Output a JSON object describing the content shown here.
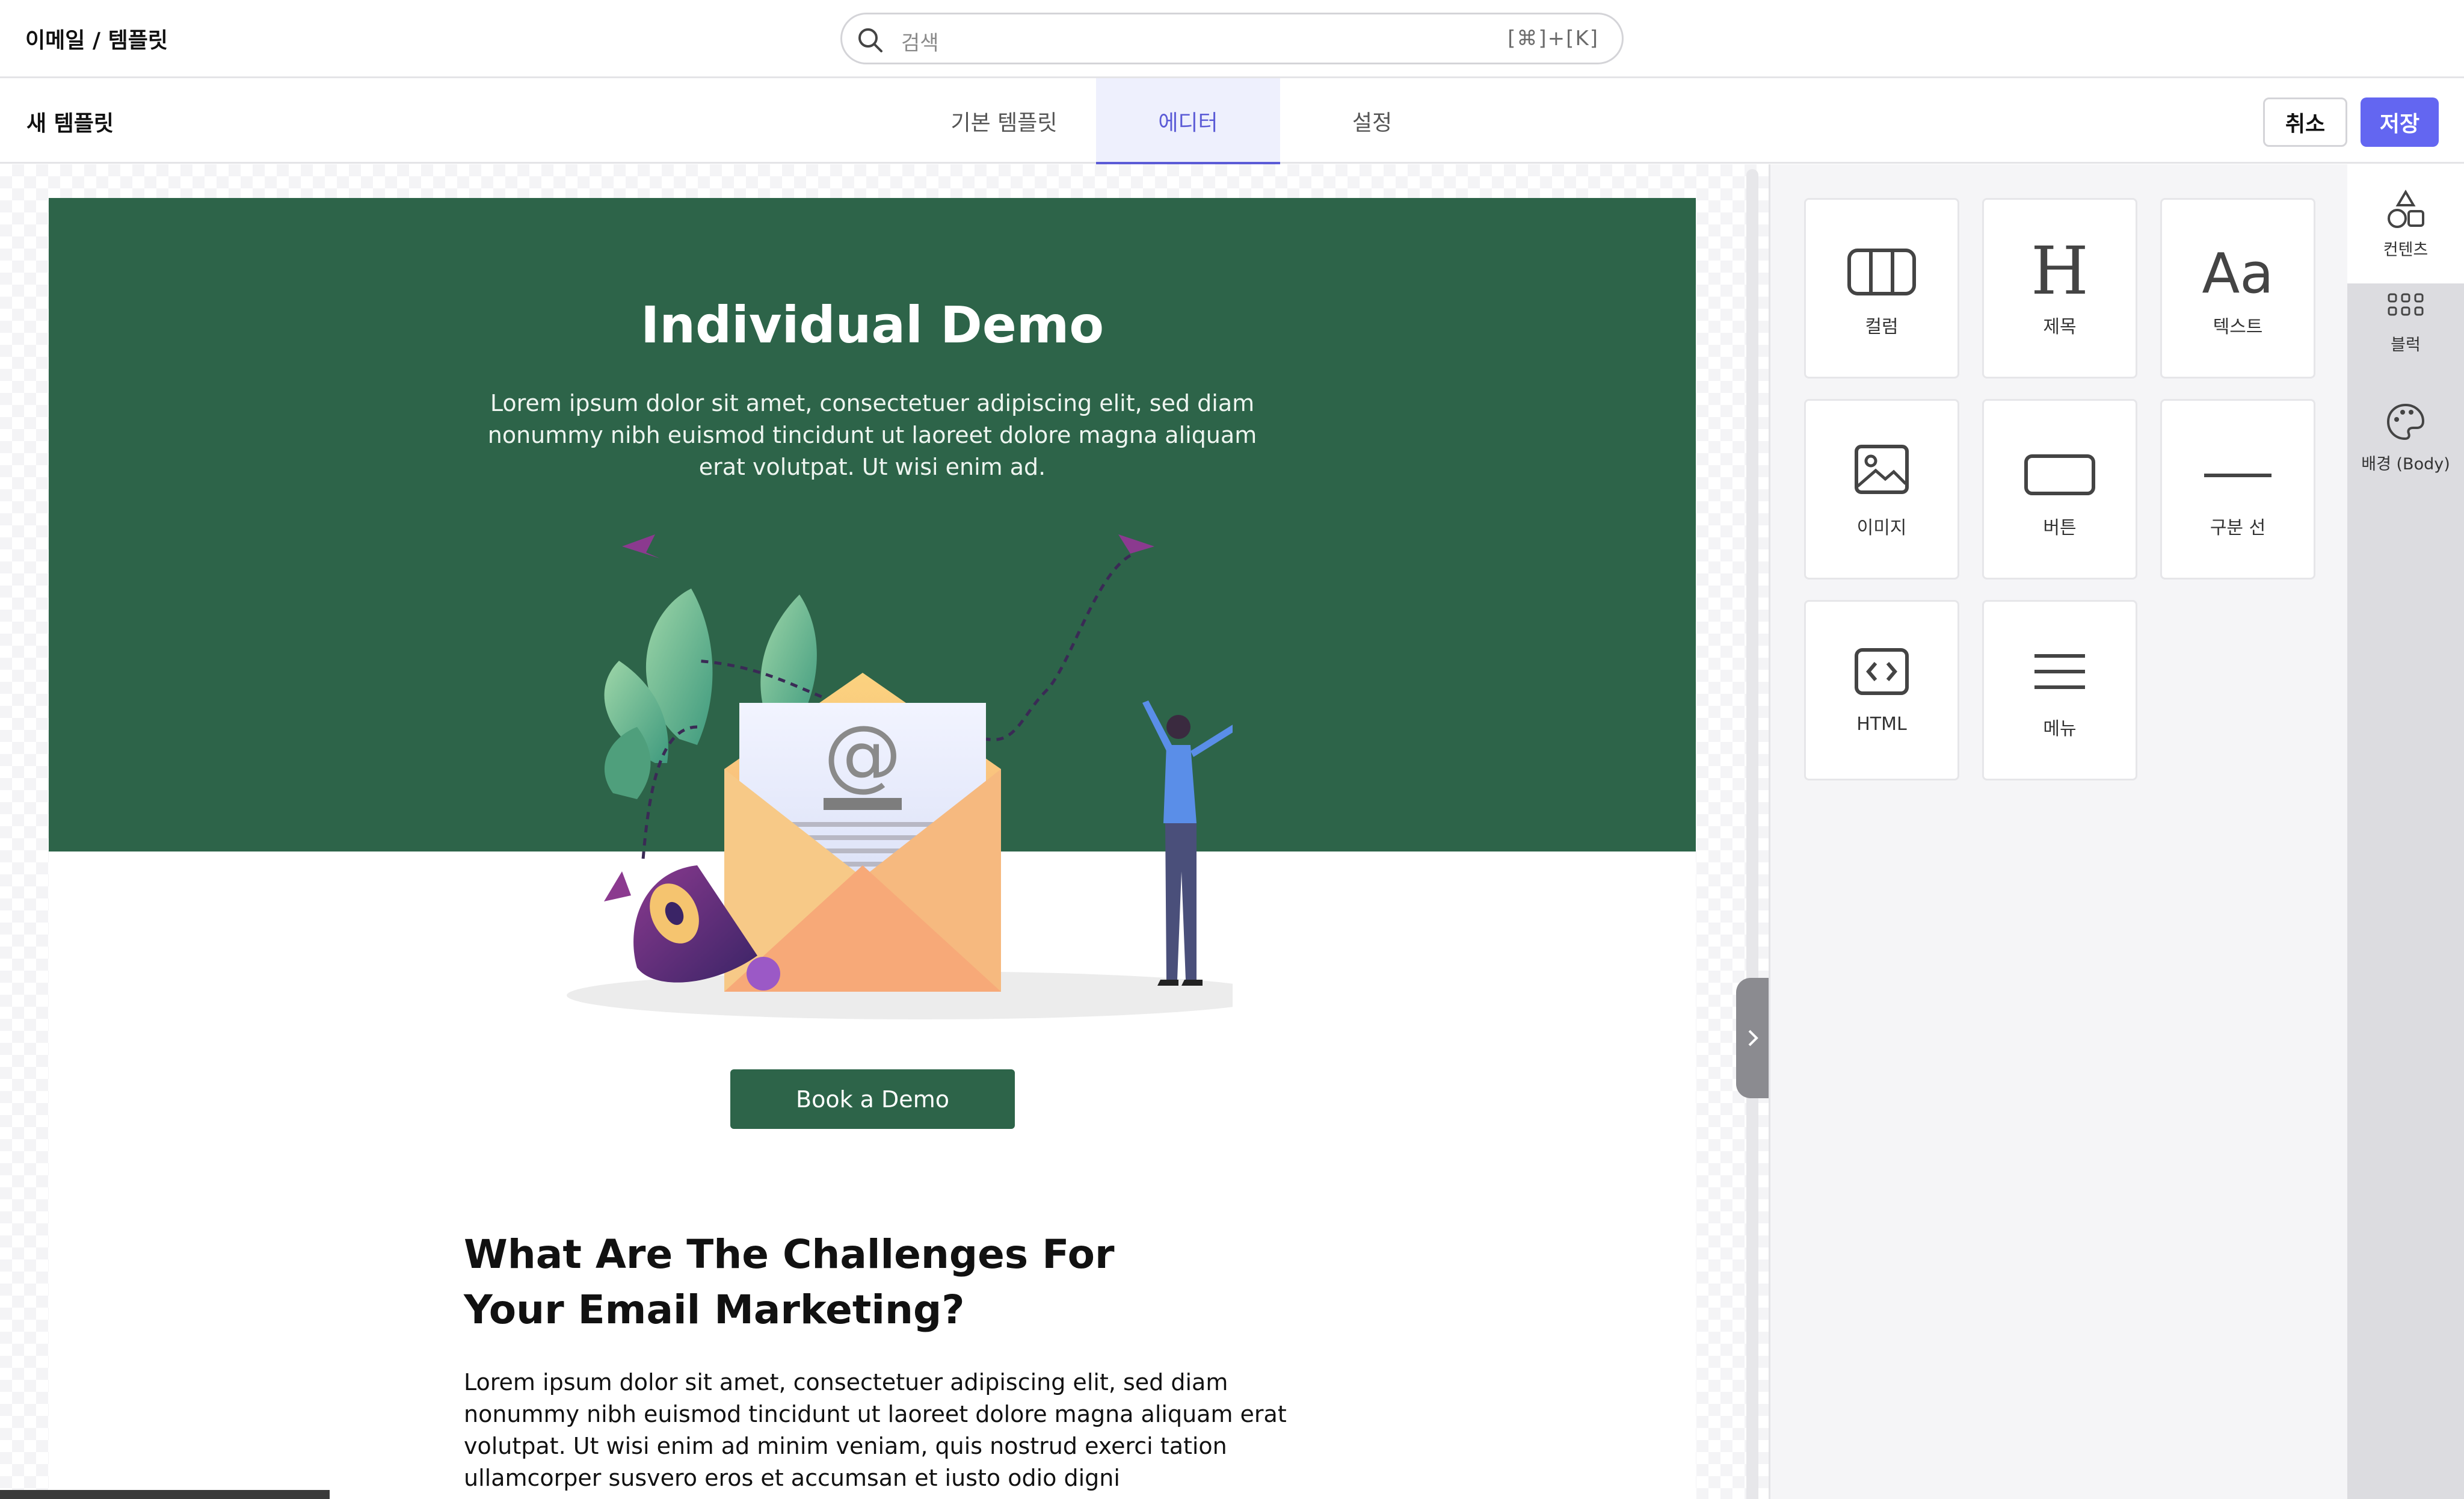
{
  "header": {
    "breadcrumb": "이메일 / 템플릿",
    "search": {
      "placeholder": "검색",
      "shortcut": "[⌘]+[K]"
    }
  },
  "toolbar": {
    "template_name": "새 템플릿",
    "tabs": [
      {
        "label": "기본 템플릿",
        "active": false
      },
      {
        "label": "에디터",
        "active": true
      },
      {
        "label": "설정",
        "active": false
      }
    ],
    "cancel_label": "취소",
    "save_label": "저장"
  },
  "email": {
    "hero_title": "Individual Demo",
    "hero_body": "Lorem ipsum dolor sit amet, consectetuer adipiscing elit, sed diam nonummy nibh euismod tincidunt ut laoreet dolore magna aliquam erat volutpat. Ut wisi enim ad.",
    "cta_label": "Book a Demo",
    "section_title": "What Are The Challenges For Your Email Marketing?",
    "section_body": "Lorem ipsum dolor sit amet, consectetuer adipiscing elit, sed diam nonummy nibh euismod tincidunt ut laoreet dolore magna aliquam erat volutpat. Ut wisi enim ad minim veniam, quis nostrud exerci tation ullamcorper susvero eros et accumsan et iusto odio digni"
  },
  "panel": {
    "blocks": [
      {
        "label": "컬럼",
        "icon": "columns-icon"
      },
      {
        "label": "제목",
        "icon": "heading-icon"
      },
      {
        "label": "텍스트",
        "icon": "text-icon"
      },
      {
        "label": "이미지",
        "icon": "image-icon"
      },
      {
        "label": "버튼",
        "icon": "button-icon"
      },
      {
        "label": "구분 선",
        "icon": "divider-icon"
      },
      {
        "label": "HTML",
        "icon": "html-code-icon"
      },
      {
        "label": "메뉴",
        "icon": "menu-icon"
      }
    ]
  },
  "rail": {
    "items": [
      {
        "label": "컨텐츠",
        "icon": "shapes-icon",
        "active": true
      },
      {
        "label": "블럭",
        "icon": "grid-dots-icon",
        "active": false
      },
      {
        "label": "배경 (Body)",
        "icon": "palette-icon",
        "active": false
      }
    ]
  },
  "colors": {
    "accent": "#6366f1",
    "hero_green": "#2d6449",
    "active_tab_bg": "#eef0fd"
  }
}
